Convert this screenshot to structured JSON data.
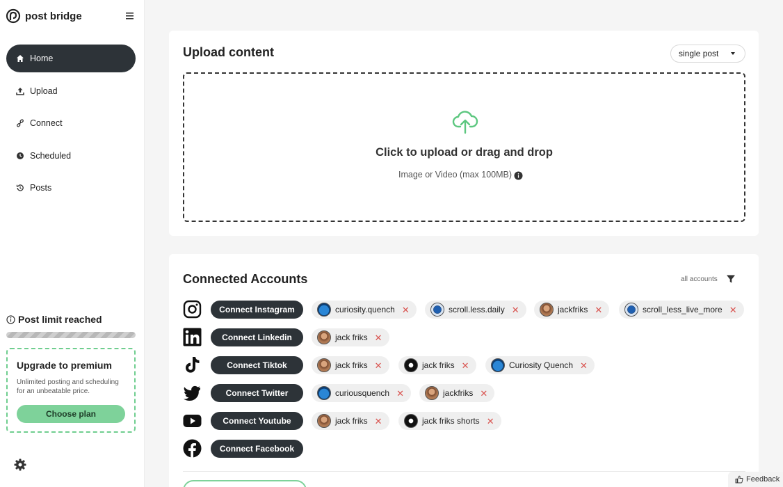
{
  "brand": {
    "name": "post bridge"
  },
  "nav": {
    "items": [
      {
        "label": "Home",
        "icon": "home-icon",
        "active": true
      },
      {
        "label": "Upload",
        "icon": "upload-icon"
      },
      {
        "label": "Connect",
        "icon": "link-icon"
      },
      {
        "label": "Scheduled",
        "icon": "clock-icon"
      },
      {
        "label": "Posts",
        "icon": "history-icon"
      }
    ]
  },
  "limit": {
    "text": "Post limit reached"
  },
  "premium": {
    "title": "Upgrade to premium",
    "description": "Unlimited posting and scheduling for an unbeatable price.",
    "button": "Choose plan"
  },
  "upload": {
    "title": "Upload content",
    "post_type": "single post",
    "drop_title": "Click to upload or drag and drop",
    "drop_subtitle": "Image or Video (max 100MB)"
  },
  "accounts": {
    "title": "Connected Accounts",
    "filter_label": "all accounts",
    "platforms": [
      {
        "name": "instagram",
        "button": "Connect Instagram",
        "chips": [
          {
            "label": "curiosity.quench",
            "avatar": "blue"
          },
          {
            "label": "scroll.less.daily",
            "avatar": "dark"
          },
          {
            "label": "jackfriks",
            "avatar": "face"
          },
          {
            "label": "scroll_less_live_more",
            "avatar": "dark"
          }
        ]
      },
      {
        "name": "linkedin",
        "button": "Connect Linkedin",
        "chips": [
          {
            "label": "jack friks",
            "avatar": "face"
          }
        ]
      },
      {
        "name": "tiktok",
        "button": "Connect Tiktok",
        "chips": [
          {
            "label": "jack friks",
            "avatar": "face"
          },
          {
            "label": "jack friks",
            "avatar": "bw"
          },
          {
            "label": "Curiosity Quench",
            "avatar": "blue"
          }
        ]
      },
      {
        "name": "twitter",
        "button": "Connect Twitter",
        "chips": [
          {
            "label": "curiousquench",
            "avatar": "blue"
          },
          {
            "label": "jackfriks",
            "avatar": "face"
          }
        ]
      },
      {
        "name": "youtube",
        "button": "Connect Youtube",
        "chips": [
          {
            "label": "jack friks",
            "avatar": "face"
          },
          {
            "label": "jack friks shorts",
            "avatar": "bw"
          }
        ]
      },
      {
        "name": "facebook",
        "button": "Connect Facebook",
        "chips": []
      }
    ]
  },
  "feedback": {
    "label": "Feedback"
  },
  "colors": {
    "accent_green": "#7ed29a",
    "dark": "#2d3338",
    "remove_red": "#d9534f"
  }
}
